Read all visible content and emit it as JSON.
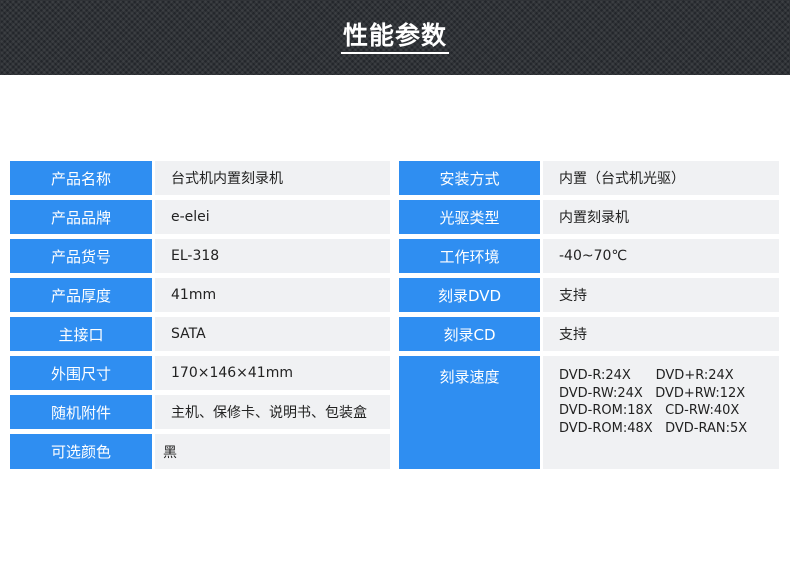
{
  "header": {
    "title": "性能参数"
  },
  "left_specs": [
    {
      "label": "产品名称",
      "value": "台式机内置刻录机"
    },
    {
      "label": "产品品牌",
      "value": "e-elei"
    },
    {
      "label": "产品货号",
      "value": "EL-318"
    },
    {
      "label": "产品厚度",
      "value": "41mm"
    },
    {
      "label": "主接口",
      "value": "SATA"
    },
    {
      "label": "外围尺寸",
      "value": "170×146×41mm"
    },
    {
      "label": "随机附件",
      "value": "主机、保修卡、说明书、包装盒"
    },
    {
      "label": "可选颜色",
      "value": "黑"
    }
  ],
  "right_specs": [
    {
      "label": "安装方式",
      "value": "内置（台式机光驱）"
    },
    {
      "label": "光驱类型",
      "value": "内置刻录机"
    },
    {
      "label": "工作环境",
      "value": "-40~70℃"
    },
    {
      "label": "刻录DVD",
      "value": "支持"
    },
    {
      "label": "刻录CD",
      "value": "支持"
    },
    {
      "label": "刻录速度",
      "lines": [
        "DVD-R:24X      DVD+R:24X",
        "DVD-RW:24X   DVD+RW:12X",
        "DVD-ROM:18X   CD-RW:40X",
        "DVD-ROM:48X   DVD-RAN:5X"
      ]
    }
  ],
  "colors": {
    "label_bg": "#2f8ef1",
    "value_bg": "#f0f1f3",
    "header_bg": "#23262b"
  }
}
